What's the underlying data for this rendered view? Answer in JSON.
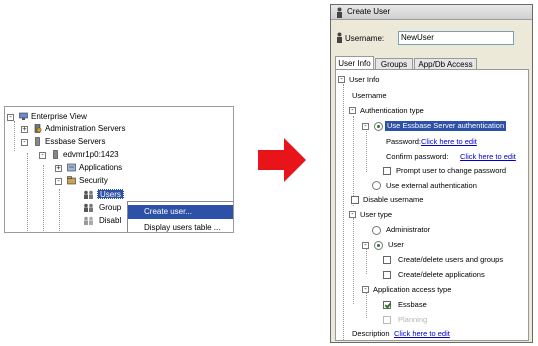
{
  "left_tree": {
    "items": [
      {
        "label": "Enterprise View",
        "expander": "-"
      },
      {
        "label": "Administration Servers",
        "expander": "+"
      },
      {
        "label": "Essbase Servers",
        "expander": "-"
      },
      {
        "label": "edvmr1p0:1423",
        "expander": "-"
      },
      {
        "label": "Applications",
        "expander": "+"
      },
      {
        "label": "Security",
        "expander": "-"
      },
      {
        "label": "Users",
        "expander": ""
      },
      {
        "label": "Group",
        "expander": ""
      },
      {
        "label": "Disabl",
        "expander": ""
      }
    ]
  },
  "context_menu": {
    "items": [
      "Create user...",
      "Display users table ..."
    ]
  },
  "dialog": {
    "title": "Create User",
    "username_label": "Username:",
    "username_value": "NewUser",
    "tabs": [
      "User Info",
      "Groups",
      "App/Db Access"
    ],
    "tree": {
      "root": "User Info",
      "username": "Username",
      "auth_type": "Authentication type",
      "use_essbase_auth": "Use Essbase Server authentication",
      "password_label": "Password:",
      "password_link": "Click here to edit",
      "confirm_label": "Confirm password:",
      "confirm_link": "Click here to edit",
      "prompt_change": "Prompt user to change password",
      "use_external": "Use external authentication",
      "disable_username": "Disable username",
      "user_type": "User type",
      "administrator": "Administrator",
      "user": "User",
      "create_users_groups": "Create/delete users and groups",
      "create_apps": "Create/delete applications",
      "app_access_type": "Application access type",
      "essbase": "Essbase",
      "planning": "Planning",
      "description_label": "Description",
      "description_link": "Click here to edit"
    }
  },
  "colors": {
    "selection": "#2c51a6",
    "arrow": "#e8141a",
    "link": "#0000cc"
  }
}
